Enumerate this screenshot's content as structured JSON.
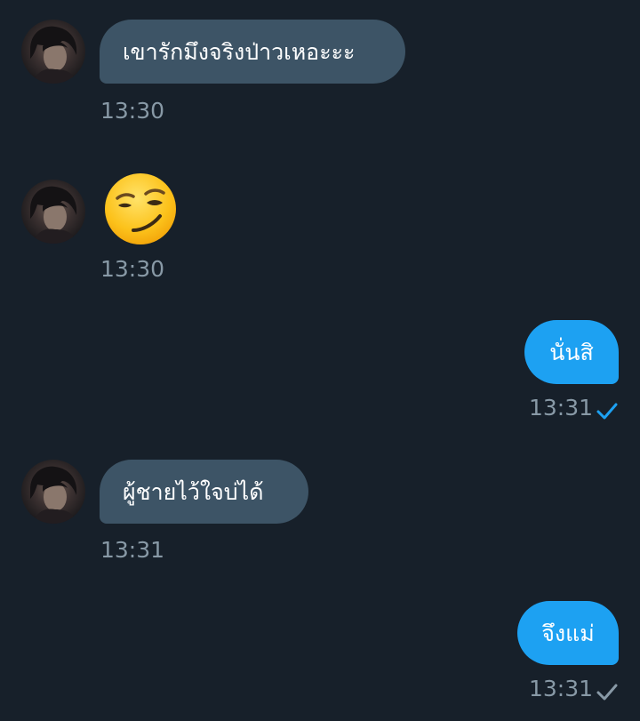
{
  "messages": [
    {
      "direction": "incoming",
      "text": "เขารักมึงจริงป่าวเหอะะะ",
      "time": "13:30"
    },
    {
      "direction": "incoming",
      "emoji": "smirking-face",
      "time": "13:30"
    },
    {
      "direction": "outgoing",
      "text": "นั่นสิ",
      "time": "13:31",
      "status": "sent",
      "status_color": "#1da1f2"
    },
    {
      "direction": "incoming",
      "text": "ผู้ชายไว้ใจบ่ได้",
      "time": "13:31"
    },
    {
      "direction": "outgoing",
      "text": "จึงแม่",
      "time": "13:31",
      "status": "read",
      "status_color": "#8899a6"
    }
  ],
  "colors": {
    "background": "#17202a",
    "incoming_bubble": "#3d5466",
    "outgoing_bubble": "#1da1f2",
    "timestamp": "#8899a6"
  }
}
